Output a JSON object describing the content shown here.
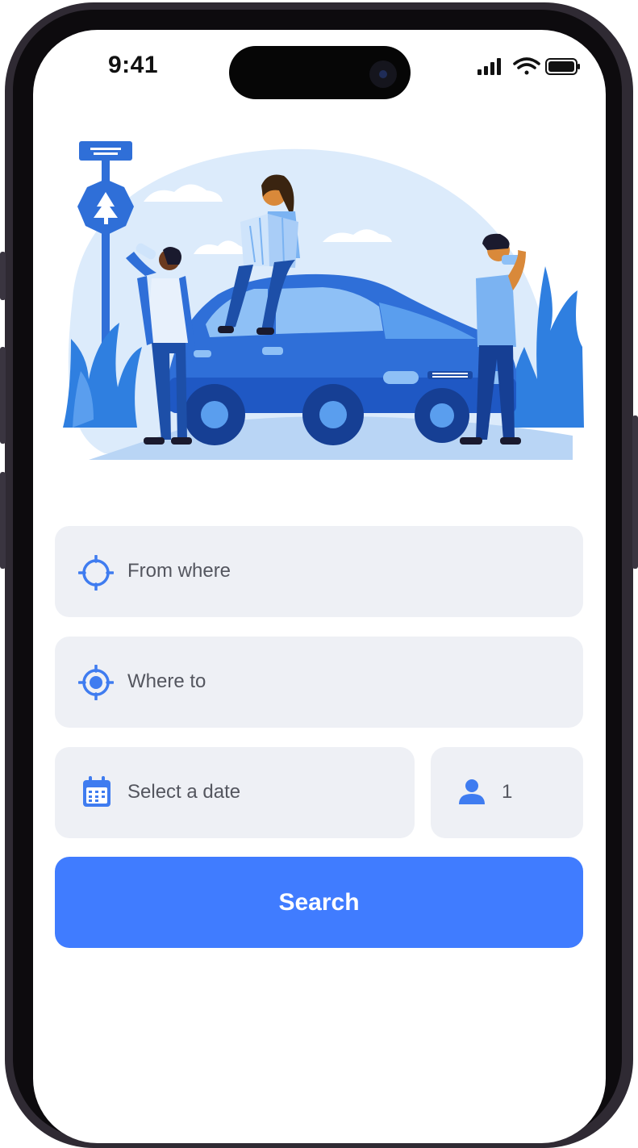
{
  "status_bar": {
    "time": "9:41"
  },
  "search_form": {
    "from_placeholder": "From where",
    "to_placeholder": "Where to",
    "date_placeholder": "Select a date",
    "passengers": "1",
    "search_label": "Search"
  },
  "colors": {
    "accent": "#407cff",
    "field_bg": "#eef0f5",
    "icon_blue": "#3f7cf0",
    "illustration_blue": "#2f6fd8"
  },
  "icons": {
    "from": "crosshair-icon",
    "to": "target-location-icon",
    "date": "calendar-icon",
    "passenger": "person-icon"
  }
}
